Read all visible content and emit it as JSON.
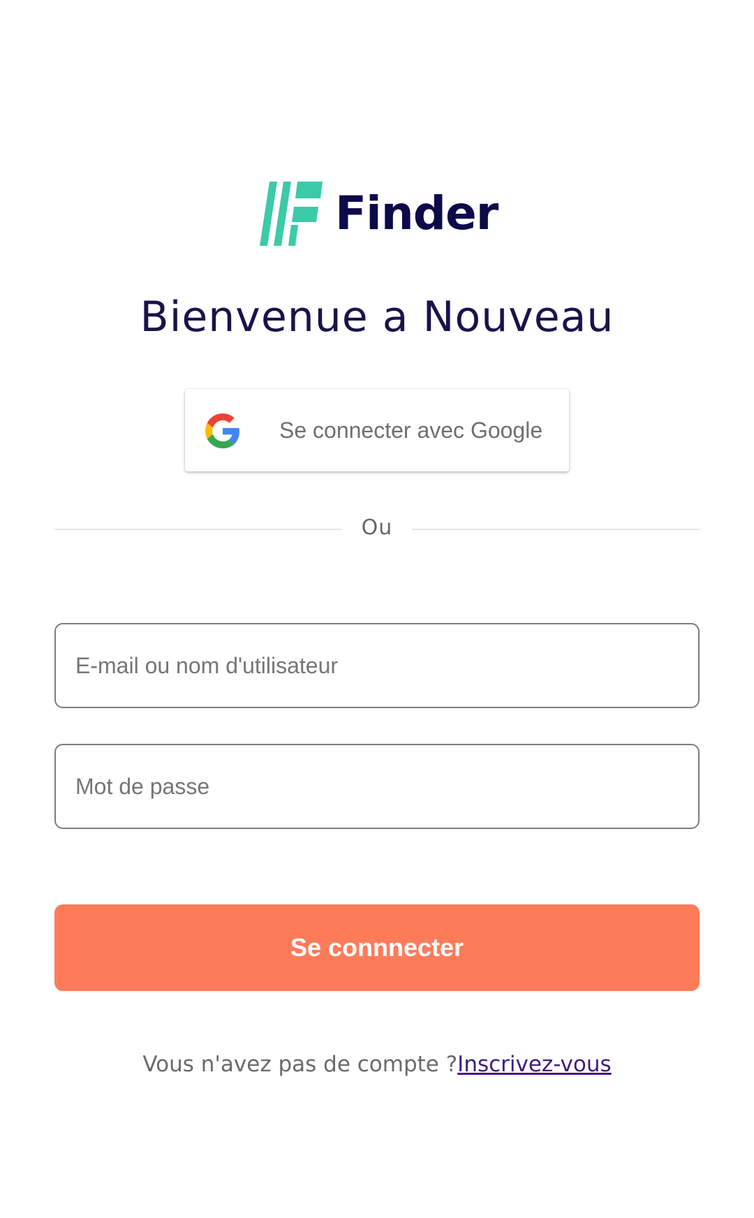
{
  "brand": {
    "name": "Finder",
    "logo_icon": "finder-logo-mark",
    "logo_color": "#3ccaa8",
    "text_color": "#0d0a4a"
  },
  "welcome": {
    "title": "Bienvenue a Nouveau"
  },
  "google": {
    "label": "Se connecter avec Google",
    "icon": "google-g-icon"
  },
  "divider": {
    "label": "Ou"
  },
  "form": {
    "email_placeholder": "E-mail ou nom d'utilisateur",
    "email_value": "",
    "password_placeholder": "Mot de passe",
    "password_value": ""
  },
  "submit": {
    "label": "Se connnecter",
    "color": "#fe7b5a"
  },
  "footer": {
    "text": "Vous n'avez pas de compte ?",
    "link": "Inscrivez-vous"
  }
}
